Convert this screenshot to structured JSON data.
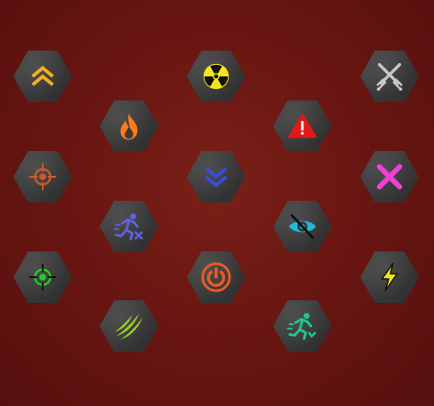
{
  "panel": {
    "background_color": "#6a1612",
    "tile_color": "#3a3a3a"
  },
  "icons": [
    {
      "name": "rank-up-icon",
      "color": "#f0b020"
    },
    {
      "name": "target-icon",
      "color": "#d0592a"
    },
    {
      "name": "target-icon",
      "color": "#1fd020"
    },
    {
      "name": "fire-icon",
      "color": "#ff7b1e"
    },
    {
      "name": "run-blocked-icon",
      "color": "#6060e0"
    },
    {
      "name": "claw-slash-icon",
      "color": "#9ad020"
    },
    {
      "name": "radiation-icon",
      "color": "#f4e61a"
    },
    {
      "name": "rank-down-icon",
      "color": "#3a4cd8"
    },
    {
      "name": "power-icon",
      "color": "#f05a22"
    },
    {
      "name": "warning-icon",
      "color": "#e01818"
    },
    {
      "name": "eye-hidden-icon",
      "color": "#20b8d8"
    },
    {
      "name": "run-slow-icon",
      "color": "#1fc88a"
    },
    {
      "name": "crossed-swords-icon",
      "color": "#c8c8c8"
    },
    {
      "name": "cross-icon",
      "color": "#f040d8"
    },
    {
      "name": "lightning-icon",
      "color": "#f0e020"
    }
  ]
}
